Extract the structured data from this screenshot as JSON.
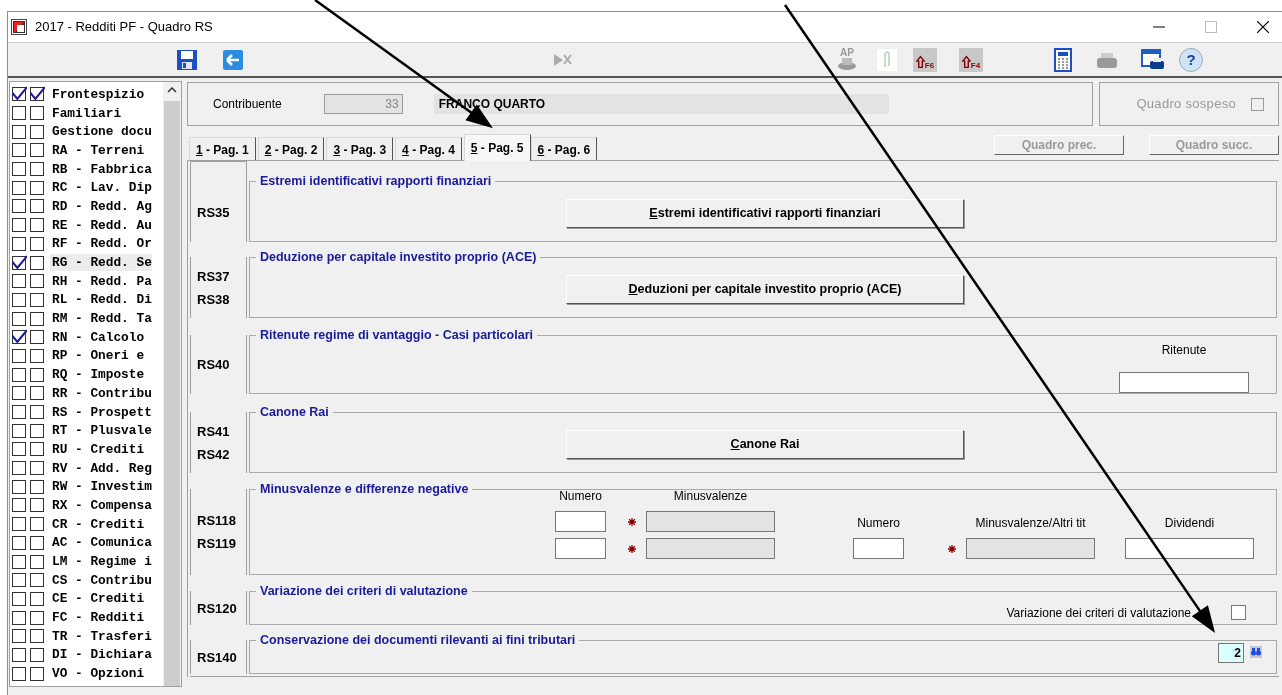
{
  "window": {
    "title": "2017 - Redditi PF - Quadro RS"
  },
  "toolbar": {
    "items": [
      {
        "kind": "save"
      },
      {
        "kind": "back"
      },
      {
        "kind": "stop"
      },
      {
        "kind": "ap",
        "label": "AP"
      },
      {
        "kind": "clip"
      },
      {
        "kind": "key",
        "label": "F6"
      },
      {
        "kind": "key",
        "label": "F4"
      },
      {
        "kind": "calc"
      },
      {
        "kind": "print"
      },
      {
        "kind": "print-window"
      },
      {
        "kind": "help",
        "label": "?"
      }
    ]
  },
  "sidebar": {
    "items": [
      {
        "label": "Frontespizio",
        "checks": [
          true,
          true
        ],
        "selected": false
      },
      {
        "label": "Familiari",
        "checks": [
          false,
          false
        ],
        "selected": false
      },
      {
        "label": "Gestione docu",
        "checks": [
          false,
          false
        ],
        "selected": false
      },
      {
        "label": "RA - Terreni",
        "checks": [
          false,
          false
        ],
        "selected": false
      },
      {
        "label": "RB - Fabbrica",
        "checks": [
          false,
          false
        ],
        "selected": false
      },
      {
        "label": "RC - Lav. Dip",
        "checks": [
          false,
          false
        ],
        "selected": false
      },
      {
        "label": "RD - Redd. Ag",
        "checks": [
          false,
          false
        ],
        "selected": false
      },
      {
        "label": "RE - Redd. Au",
        "checks": [
          false,
          false
        ],
        "selected": false
      },
      {
        "label": "RF - Redd. Or",
        "checks": [
          false,
          false
        ],
        "selected": false
      },
      {
        "label": "RG - Redd. Se",
        "checks": [
          true,
          false
        ],
        "selected": true
      },
      {
        "label": "RH - Redd. Pa",
        "checks": [
          false,
          false
        ],
        "selected": false
      },
      {
        "label": "RL - Redd. Di",
        "checks": [
          false,
          false
        ],
        "selected": false
      },
      {
        "label": "RM - Redd. Ta",
        "checks": [
          false,
          false
        ],
        "selected": false
      },
      {
        "label": "RN - Calcolo",
        "checks": [
          true,
          false
        ],
        "selected": false
      },
      {
        "label": "RP - Oneri e",
        "checks": [
          false,
          false
        ],
        "selected": false
      },
      {
        "label": "RQ - Imposte",
        "checks": [
          false,
          false
        ],
        "selected": false
      },
      {
        "label": "RR - Contribu",
        "checks": [
          false,
          false
        ],
        "selected": false
      },
      {
        "label": "RS - Prospett",
        "checks": [
          false,
          false
        ],
        "selected": false
      },
      {
        "label": "RT - Plusvale",
        "checks": [
          false,
          false
        ],
        "selected": false
      },
      {
        "label": "RU - Crediti",
        "checks": [
          false,
          false
        ],
        "selected": false
      },
      {
        "label": "RV - Add. Reg",
        "checks": [
          false,
          false
        ],
        "selected": false
      },
      {
        "label": "RW - Investim",
        "checks": [
          false,
          false
        ],
        "selected": false
      },
      {
        "label": "RX - Compensa",
        "checks": [
          false,
          false
        ],
        "selected": false
      },
      {
        "label": "CR - Crediti",
        "checks": [
          false,
          false
        ],
        "selected": false
      },
      {
        "label": "AC - Comunica",
        "checks": [
          false,
          false
        ],
        "selected": false
      },
      {
        "label": "LM - Regime i",
        "checks": [
          false,
          false
        ],
        "selected": false
      },
      {
        "label": "CS - Contribu",
        "checks": [
          false,
          false
        ],
        "selected": false
      },
      {
        "label": "CE - Crediti",
        "checks": [
          false,
          false
        ],
        "selected": false
      },
      {
        "label": "FC - Redditi",
        "checks": [
          false,
          false
        ],
        "selected": false
      },
      {
        "label": "TR - Trasferi",
        "checks": [
          false,
          false
        ],
        "selected": false
      },
      {
        "label": "DI - Dichiara",
        "checks": [
          false,
          false
        ],
        "selected": false
      },
      {
        "label": "VO - Opzioni",
        "checks": [
          false,
          false
        ],
        "selected": false
      }
    ]
  },
  "header": {
    "label": "Contribuente",
    "code": "33",
    "name": "FRANCO QUARTO",
    "suspended": {
      "label": "Quadro sospeso",
      "checked": false,
      "disabled": true
    }
  },
  "tabs": [
    {
      "label": "1 - Pag. 1",
      "selected": false
    },
    {
      "label": "2 - Pag. 2",
      "selected": false
    },
    {
      "label": "3 - Pag. 3",
      "selected": false
    },
    {
      "label": "4 - Pag. 4",
      "selected": false
    },
    {
      "label": "5 - Pag. 5",
      "selected": true
    },
    {
      "label": "6 - Pag. 6",
      "selected": false
    }
  ],
  "nav_buttons": [
    {
      "label": "Quadro prec.",
      "disabled": true
    },
    {
      "label": "Quadro succ.",
      "disabled": true
    }
  ],
  "sections": [
    {
      "kind": "button",
      "rows": [
        "RS35"
      ],
      "title": "Estremi identificativi rapporti finanziari",
      "button": "Estremi identificativi rapporti finanziari"
    },
    {
      "kind": "button",
      "rows": [
        "RS37",
        "RS38"
      ],
      "title": "Deduzione per capitale investito proprio (ACE)",
      "button": "Deduzioni per capitale investito proprio (ACE)"
    },
    {
      "kind": "field",
      "rows": [
        "RS40"
      ],
      "title": "Ritenute regime di vantaggio - Casi particolari",
      "field_label": "Ritenute"
    },
    {
      "kind": "button",
      "rows": [
        "RS41",
        "RS42"
      ],
      "title": "Canone Rai",
      "button": "Canone Rai"
    },
    {
      "kind": "grid",
      "rows": [
        "RS118",
        "RS119"
      ],
      "title": "Minusvalenze e differenze negative",
      "groups": [
        {
          "headers": [
            "Numero",
            "Minusvalenze"
          ],
          "lines": [
            [
              {
                "required": false,
                "disabled": false
              },
              {
                "required": true,
                "disabled": true
              }
            ],
            [
              {
                "required": false,
                "disabled": false
              },
              {
                "required": true,
                "disabled": true
              }
            ]
          ]
        },
        {
          "headers": [
            "Numero",
            "Minusvalenze/Altri tit",
            "Dividendi"
          ],
          "lines": [
            [
              {
                "required": false,
                "disabled": false
              },
              {
                "required": true,
                "disabled": true
              },
              {
                "required": false,
                "disabled": false
              }
            ]
          ]
        }
      ]
    },
    {
      "kind": "checkbox",
      "rows": [
        "RS120"
      ],
      "title": "Variazione dei criteri di valutazione",
      "check_label": "Variazione dei criteri di valutazione",
      "checked": false
    },
    {
      "kind": "number",
      "rows": [
        "RS140"
      ],
      "title": "Conservazione dei documenti rilevanti ai fini tributari",
      "value": "2"
    }
  ]
}
